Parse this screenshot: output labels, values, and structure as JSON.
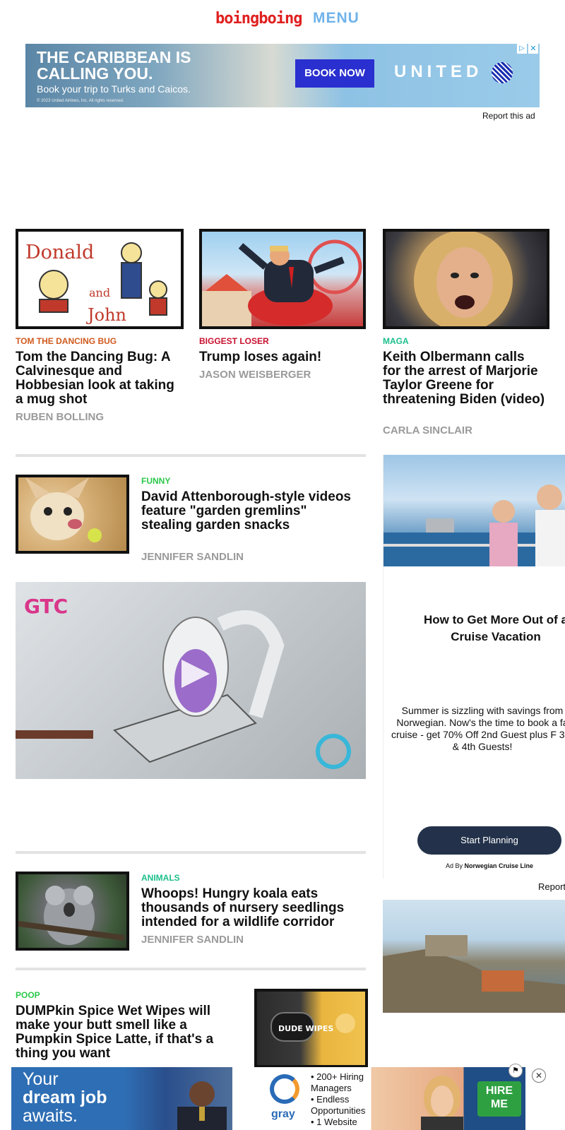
{
  "header": {
    "logo": "boingboing",
    "menu_label": "MENU"
  },
  "top_ad": {
    "headline": "THE CARIBBEAN IS CALLING YOU.",
    "subtext": "Book your trip to Turks and Caicos.",
    "fine_print": "© 2023 United Airlines, Inc. All rights reserved.",
    "cta": "BOOK NOW",
    "brand": "UNITED",
    "adchoices_icon": "adchoices-icon",
    "close_icon": "close-icon",
    "report_label": "Report this ad"
  },
  "posts": [
    {
      "kicker": "TOM THE DANCING BUG",
      "kicker_color": "#d15a1e",
      "title": "Tom the Dancing Bug: A Calvinesque and Hobbesian look at taking a mug shot",
      "author": "RUBEN BOLLING",
      "image_text": [
        "Donald",
        "and",
        "John"
      ]
    },
    {
      "kicker": "BIGGEST LOSER",
      "kicker_color": "#c8102e",
      "title": "Trump loses again!",
      "author": "JASON WEISBERGER"
    },
    {
      "kicker": "MAGA",
      "kicker_color": "#1bbf8a",
      "title": "Keith Olbermann calls for the arrest of Marjorie Taylor Greene for threatening Biden (video)",
      "author": "CARLA SINCLAIR"
    },
    {
      "kicker": "FUNNY",
      "kicker_color": "#2bc84a",
      "title": "David Attenborough-style videos feature \"garden gremlins\" stealing garden snacks",
      "author": "JENNIFER SANDLIN"
    },
    {
      "kicker": "ANIMALS",
      "kicker_color": "#1bbf8a",
      "title": "Whoops! Hungry koala eats thousands of nursery seedlings intended for a wildlife corridor",
      "author": "JENNIFER SANDLIN"
    },
    {
      "kicker": "POOP",
      "kicker_color": "#2bc84a",
      "title": "DUMPkin Spice Wet Wipes will make your butt smell like a Pumpkin Spice Latte, if that's a thing you want",
      "image_text": "DUDE WIPES"
    }
  ],
  "video_ad": {
    "badge": "GTC",
    "play_icon": "play-icon"
  },
  "cruise_ad": {
    "title": "How to Get More Out of a Cruise Vacation",
    "text": "Summer is sizzling with savings from Norwegian. Now's the time to book a fa cruise - get 70% Off 2nd Guest plus F 3rd & 4th Guests!",
    "cta": "Start Planning",
    "ad_by_prefix": "Ad By",
    "ad_by_brand": "Norwegian Cruise Line",
    "report_label": "Report"
  },
  "bottom_ad": {
    "line1": "Your",
    "line2": "dream job",
    "line3": "awaits.",
    "logo": "gray",
    "bullets": [
      "200+ Hiring Managers",
      "Endless Opportunities",
      "1 Website"
    ],
    "cta": "HIRE ME",
    "flag_icon": "flag-icon",
    "close_icon": "close-icon"
  }
}
